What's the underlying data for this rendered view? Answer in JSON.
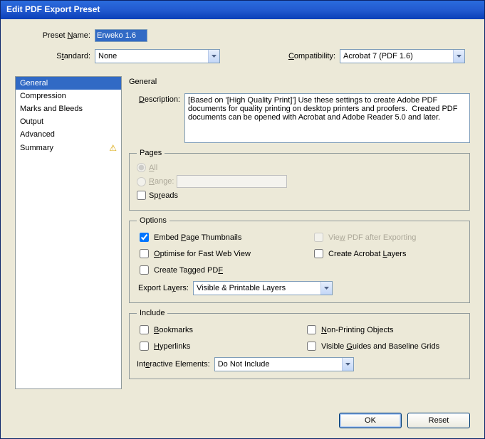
{
  "window": {
    "title": "Edit PDF Export Preset"
  },
  "labels": {
    "preset_name": "Preset Name:",
    "standard": "Standard:",
    "compatibility": "Compatibility:",
    "description": "Description:",
    "pages": "Pages",
    "all": "All",
    "range": "Range:",
    "spreads": "Spreads",
    "options": "Options",
    "embed_thumbs": "Embed Page Thumbnails",
    "optimise_fwv": "Optimise for Fast Web View",
    "create_tagged": "Create Tagged PDF",
    "view_after": "View PDF after Exporting",
    "create_layers": "Create Acrobat Layers",
    "export_layers": "Export Layers:",
    "include": "Include",
    "bookmarks": "Bookmarks",
    "hyperlinks": "Hyperlinks",
    "nonprint": "Non-Printing Objects",
    "visible_guides": "Visible Guides and Baseline Grids",
    "interactive": "Interactive Elements:"
  },
  "values": {
    "preset_name": "Erweko 1.6",
    "standard": "None",
    "compatibility": "Acrobat 7 (PDF 1.6)",
    "description": "[Based on '[High Quality Print]'] Use these settings to create Adobe PDF documents for quality printing on desktop printers and proofers.  Created PDF documents can be opened with Acrobat and Adobe Reader 5.0 and later.",
    "pages_mode": "All",
    "range": "",
    "spreads": false,
    "embed_thumbs": true,
    "optimise_fwv": false,
    "create_tagged": false,
    "view_after": false,
    "create_layers": false,
    "export_layers": "Visible & Printable Layers",
    "bookmarks": false,
    "hyperlinks": false,
    "nonprint": false,
    "visible_guides": false,
    "interactive": "Do Not Include"
  },
  "sidebar": {
    "items": [
      {
        "label": "General",
        "selected": true
      },
      {
        "label": "Compression"
      },
      {
        "label": "Marks and Bleeds"
      },
      {
        "label": "Output"
      },
      {
        "label": "Advanced"
      },
      {
        "label": "Summary",
        "warn": true
      }
    ]
  },
  "section_heading": "General",
  "buttons": {
    "ok": "OK",
    "reset": "Reset"
  },
  "chart_data": null
}
